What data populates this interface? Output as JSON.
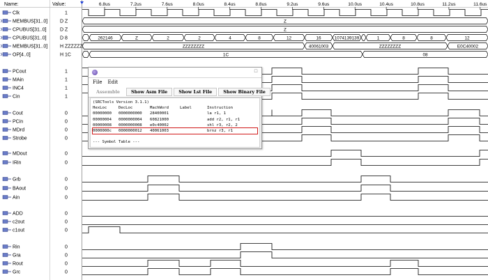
{
  "header": {
    "name_label": "Name:",
    "value_label": "Value:",
    "ticks": [
      "6.8us",
      "7.2us",
      "7.6us",
      "8.0us",
      "8.4us",
      "8.8us",
      "9.2us",
      "9.6us",
      "10.0us",
      "10.4us",
      "10.8us",
      "11.2us",
      "11.6us"
    ]
  },
  "signals": [
    {
      "name": "Clk",
      "value": "1",
      "kind": "bit",
      "wave": [
        [
          118,
          1
        ],
        [
          127,
          0
        ],
        [
          150,
          1
        ],
        [
          172,
          0
        ],
        [
          195,
          1
        ],
        [
          217,
          0
        ],
        [
          240,
          1
        ],
        [
          262,
          0
        ],
        [
          285,
          1
        ],
        [
          307,
          0
        ],
        [
          330,
          1
        ],
        [
          352,
          0
        ],
        [
          375,
          1
        ],
        [
          397,
          0
        ],
        [
          420,
          1
        ],
        [
          442,
          0
        ],
        [
          465,
          1
        ],
        [
          487,
          0
        ],
        [
          510,
          1
        ],
        [
          532,
          0
        ],
        [
          555,
          1
        ],
        [
          577,
          0
        ],
        [
          600,
          1
        ],
        [
          622,
          0
        ],
        [
          645,
          1
        ],
        [
          667,
          0
        ],
        [
          690,
          1
        ]
      ]
    },
    {
      "name": "MEMBUS[31..0]",
      "value": "D Z",
      "kind": "bus",
      "segs": [
        [
          118,
          700,
          "Z"
        ]
      ]
    },
    {
      "name": "CPUBUS[31..0]",
      "value": "D Z",
      "kind": "bus",
      "segs": [
        [
          118,
          700,
          "Z"
        ]
      ]
    },
    {
      "name": "CPUBUS[31..0]",
      "value": "D 8",
      "kind": "bus",
      "segs": [
        [
          118,
          128,
          "<"
        ],
        [
          128,
          174,
          "262146"
        ],
        [
          174,
          218,
          "Z"
        ],
        [
          218,
          264,
          "2"
        ],
        [
          264,
          308,
          "2"
        ],
        [
          308,
          352,
          "4"
        ],
        [
          352,
          392,
          "8"
        ],
        [
          392,
          437,
          "12"
        ],
        [
          437,
          477,
          "16"
        ],
        [
          477,
          518,
          "1074139139"
        ],
        [
          518,
          525,
          ""
        ],
        [
          525,
          560,
          "1"
        ],
        [
          560,
          598,
          "8"
        ],
        [
          598,
          640,
          "8"
        ],
        [
          640,
          700,
          "12"
        ]
      ]
    },
    {
      "name": "MEMBUS[31..0]",
      "value": "H ZZZZZZZZ",
      "kind": "bus",
      "segs": [
        [
          118,
          437,
          "ZZZZZZZZ"
        ],
        [
          437,
          477,
          "40061003"
        ],
        [
          477,
          642,
          "ZZZZZZZZ"
        ],
        [
          642,
          700,
          "E0C40002"
        ]
      ]
    },
    {
      "name": "OP[4..0]",
      "value": "H 1C",
      "kind": "bus",
      "segs": [
        [
          118,
          128,
          "<"
        ],
        [
          128,
          520,
          "1C"
        ],
        [
          520,
          700,
          "08"
        ]
      ]
    },
    {
      "name": "PCout",
      "value": "1",
      "kind": "bit",
      "wave": [
        [
          118,
          1
        ],
        [
          127,
          0
        ],
        [
          390,
          1
        ],
        [
          433,
          0
        ],
        [
          600,
          1
        ],
        [
          643,
          0
        ]
      ]
    },
    {
      "name": "MAin",
      "value": "1",
      "kind": "bit",
      "wave": [
        [
          118,
          1
        ],
        [
          127,
          0
        ],
        [
          390,
          1
        ],
        [
          433,
          0
        ],
        [
          600,
          1
        ],
        [
          643,
          0
        ]
      ]
    },
    {
      "name": "INC4",
      "value": "1",
      "kind": "bit",
      "wave": [
        [
          118,
          1
        ],
        [
          127,
          0
        ],
        [
          390,
          1
        ],
        [
          433,
          0
        ],
        [
          600,
          1
        ],
        [
          643,
          0
        ]
      ]
    },
    {
      "name": "Cin",
      "value": "1",
      "kind": "bit",
      "wave": [
        [
          118,
          1
        ],
        [
          127,
          0
        ],
        [
          390,
          1
        ],
        [
          433,
          0
        ],
        [
          600,
          1
        ],
        [
          643,
          0
        ]
      ]
    },
    {
      "name": "Cout",
      "value": "0",
      "kind": "bit",
      "wave": [
        [
          118,
          0
        ],
        [
          390,
          0
        ],
        [
          433,
          1
        ],
        [
          475,
          0
        ],
        [
          643,
          1
        ],
        [
          688,
          0
        ]
      ]
    },
    {
      "name": "PCin",
      "value": "0",
      "kind": "bit",
      "wave": [
        [
          118,
          0
        ],
        [
          433,
          1
        ],
        [
          475,
          0
        ],
        [
          643,
          1
        ],
        [
          688,
          0
        ]
      ]
    },
    {
      "name": "MDrd",
      "value": "0",
      "kind": "bit",
      "wave": [
        [
          118,
          0
        ],
        [
          433,
          1
        ],
        [
          475,
          0
        ],
        [
          643,
          1
        ],
        [
          688,
          0
        ]
      ]
    },
    {
      "name": "Strobe",
      "value": "0",
      "kind": "bit",
      "wave": [
        [
          118,
          0
        ],
        [
          433,
          1
        ],
        [
          475,
          0
        ],
        [
          643,
          1
        ],
        [
          688,
          0
        ]
      ]
    },
    {
      "name": "MDout",
      "value": "0",
      "kind": "bit",
      "wave": [
        [
          118,
          0
        ],
        [
          475,
          1
        ],
        [
          518,
          0
        ],
        [
          688,
          1
        ]
      ]
    },
    {
      "name": "IRin",
      "value": "0",
      "kind": "bit",
      "wave": [
        [
          118,
          0
        ],
        [
          475,
          1
        ],
        [
          518,
          0
        ],
        [
          688,
          1
        ]
      ]
    },
    {
      "name": "Grb",
      "value": "0",
      "kind": "bit",
      "wave": [
        [
          118,
          0
        ],
        [
          212,
          1
        ],
        [
          257,
          0
        ],
        [
          518,
          1
        ],
        [
          560,
          0
        ]
      ]
    },
    {
      "name": "BAout",
      "value": "0",
      "kind": "bit",
      "wave": [
        [
          118,
          0
        ],
        [
          212,
          1
        ],
        [
          257,
          0
        ],
        [
          518,
          1
        ],
        [
          560,
          0
        ]
      ]
    },
    {
      "name": "Ain",
      "value": "0",
      "kind": "bit",
      "wave": [
        [
          118,
          0
        ],
        [
          212,
          1
        ],
        [
          257,
          0
        ],
        [
          518,
          1
        ],
        [
          560,
          0
        ]
      ]
    },
    {
      "name": "ADD",
      "value": "0",
      "kind": "bit",
      "wave": [
        [
          118,
          0
        ]
      ]
    },
    {
      "name": "c2out",
      "value": "0",
      "kind": "bit",
      "wave": [
        [
          118,
          0
        ]
      ]
    },
    {
      "name": "c1out",
      "value": "0",
      "kind": "bit",
      "wave": [
        [
          118,
          0
        ],
        [
          127,
          1
        ],
        [
          172,
          0
        ]
      ]
    },
    {
      "name": "Rin",
      "value": "0",
      "kind": "bit",
      "wave": [
        [
          118,
          0
        ],
        [
          345,
          1
        ],
        [
          390,
          0
        ]
      ]
    },
    {
      "name": "Gra",
      "value": "0",
      "kind": "bit",
      "wave": [
        [
          118,
          0
        ],
        [
          345,
          1
        ],
        [
          390,
          0
        ]
      ]
    },
    {
      "name": "Rout",
      "value": "0",
      "kind": "bit",
      "wave": [
        [
          118,
          0
        ],
        [
          212,
          1
        ],
        [
          257,
          0
        ],
        [
          302,
          1
        ],
        [
          345,
          0
        ],
        [
          560,
          1
        ],
        [
          600,
          0
        ]
      ]
    },
    {
      "name": "Grc",
      "value": "0",
      "kind": "bit",
      "wave": [
        [
          118,
          0
        ],
        [
          212,
          1
        ],
        [
          257,
          0
        ],
        [
          302,
          1
        ],
        [
          345,
          0
        ],
        [
          560,
          1
        ],
        [
          600,
          0
        ]
      ]
    }
  ],
  "popup": {
    "menus": [
      "File",
      "Edit"
    ],
    "buttons": [
      "Assemble",
      "Show Asm File",
      "Show Lst File",
      "Show Binary File"
    ],
    "version_line": "(SRCTools Version 3.1.1)",
    "columns": [
      "HexLoc",
      "DecLoc",
      "MachWord",
      "Label",
      "Instruction"
    ],
    "rows": [
      [
        "00000000",
        "0000000000",
        "28400001",
        "",
        "la r1, 1"
      ],
      [
        "00000004",
        "0000000004",
        "60821000",
        "",
        "add r2, r1, r1"
      ],
      [
        "00000008",
        "0000000008",
        "e0c40002",
        "",
        "shl r3, r2, 2"
      ],
      [
        "0000000c",
        "0000000012",
        "40061003",
        "",
        "brnz r3, r1"
      ]
    ],
    "symbol_line": "--- Symbol Table ---"
  },
  "colors": {
    "wave": "#000000",
    "bus_fill": "#ffffff",
    "highlight": "#d01818",
    "grid": "#000000"
  }
}
